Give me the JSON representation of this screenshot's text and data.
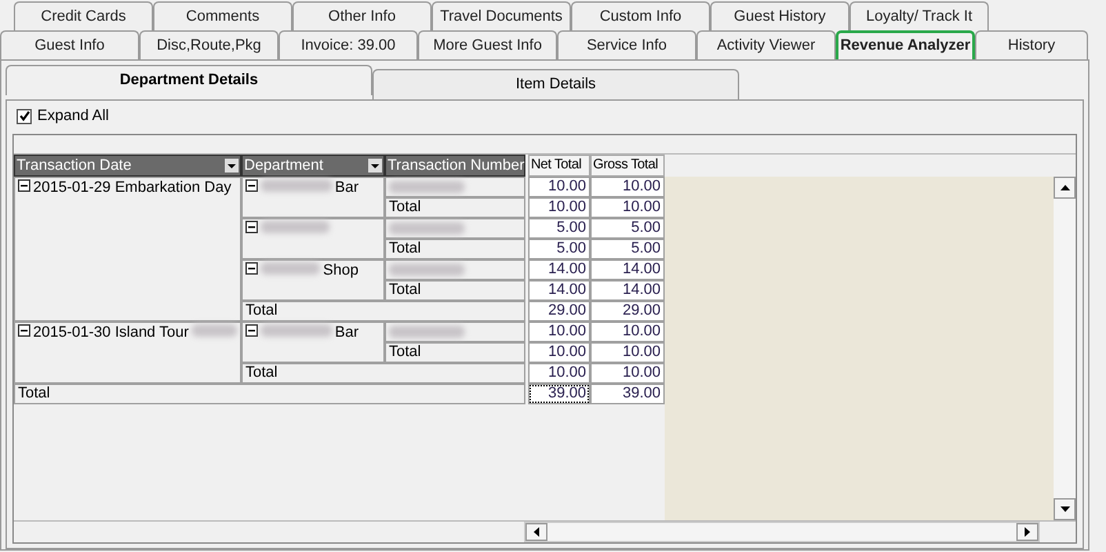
{
  "tabs_back": [
    {
      "label": "Credit Cards",
      "selected": false
    },
    {
      "label": "Comments",
      "selected": false
    },
    {
      "label": "Other Info",
      "selected": false
    },
    {
      "label": "Travel Documents",
      "selected": false
    },
    {
      "label": "Custom Info",
      "selected": false
    },
    {
      "label": "Guest History",
      "selected": false
    },
    {
      "label": "Loyalty/ Track It",
      "selected": false
    }
  ],
  "tabs_front": [
    {
      "label": "Guest Info",
      "selected": false
    },
    {
      "label": "Disc,Route,Pkg",
      "selected": false
    },
    {
      "label": "Invoice: 39.00",
      "selected": false
    },
    {
      "label": "More Guest Info",
      "selected": false
    },
    {
      "label": "Service Info",
      "selected": false
    },
    {
      "label": "Activity Viewer",
      "selected": false
    },
    {
      "label": "Revenue Analyzer",
      "selected": true
    },
    {
      "label": "History",
      "selected": false
    }
  ],
  "sub_tabs": [
    {
      "label": "Department Details",
      "selected": true
    },
    {
      "label": "Item Details",
      "selected": false
    }
  ],
  "expand_all": {
    "label": "Expand All",
    "checked": true
  },
  "pivot": {
    "row_headers": [
      "Transaction Date",
      "Department",
      "Transaction Number"
    ],
    "data_headers": [
      "Net Total",
      "Gross Total"
    ],
    "groups": [
      {
        "date": "2015-01-29 Embarkation Day",
        "expanded": true,
        "departments": [
          {
            "name": "Bar",
            "expanded": true,
            "net": "10.00",
            "gross": "10.00",
            "total": {
              "label": "Total",
              "net": "10.00",
              "gross": "10.00"
            }
          },
          {
            "expanded": true,
            "net": "5.00",
            "gross": "5.00",
            "total": {
              "label": "Total",
              "net": "5.00",
              "gross": "5.00"
            }
          },
          {
            "name": "Shop",
            "expanded": true,
            "net": "14.00",
            "gross": "14.00",
            "total": {
              "label": "Total",
              "net": "14.00",
              "gross": "14.00"
            }
          }
        ],
        "total": {
          "label": "Total",
          "net": "29.00",
          "gross": "29.00"
        }
      },
      {
        "date": "2015-01-30 Island Tour",
        "expanded": true,
        "departments": [
          {
            "name": "Bar",
            "expanded": true,
            "net": "10.00",
            "gross": "10.00",
            "total": {
              "label": "Total",
              "net": "10.00",
              "gross": "10.00"
            }
          }
        ],
        "total": {
          "label": "Total",
          "net": "10.00",
          "gross": "10.00"
        }
      }
    ],
    "grand_total": {
      "label": "Total",
      "net": "39.00",
      "gross": "39.00",
      "focused": true
    }
  }
}
